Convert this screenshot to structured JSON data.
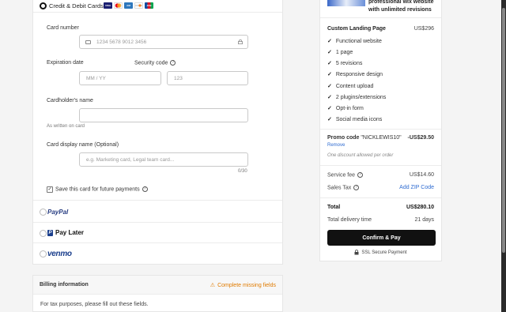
{
  "payment": {
    "credit_label": "Credit & Debit Cards",
    "card_brands": [
      "visa",
      "mastercard",
      "amex",
      "discover",
      "jcb"
    ],
    "card_number_label": "Card number",
    "card_number_placeholder": "1234 5678 9012 3456",
    "expiration_label": "Expiration date",
    "expiration_placeholder": "MM / YY",
    "security_label": "Security code",
    "security_placeholder": "123",
    "holder_label": "Cardholder's name",
    "holder_hint": "As written on card",
    "display_label": "Card display name (Optional)",
    "display_placeholder": "e.g. Marketing card, Legal team card...",
    "display_counter": "0/30",
    "save_label": "Save this card for future payments",
    "save_checked": "✓",
    "paypal_label": "PayPal",
    "paylater_label": "Pay Later",
    "paylater_icon": "P",
    "venmo_label": "venmo"
  },
  "billing": {
    "title": "Billing information",
    "warning": "Complete missing fields",
    "warning_icon": "⚠",
    "description": "For tax purposes, please fill out these fields."
  },
  "summary": {
    "gig_title": "professional wix website with unlimited revisions",
    "package_name": "Custom Landing Page",
    "package_price": "US$296",
    "check_glyph": "✓",
    "features": [
      "Functional website",
      "1 page",
      "5 revisions",
      "Responsive design",
      "Content upload",
      "2 plugins/extensions",
      "Opt-in form",
      "Social media icons"
    ],
    "promo_prefix": "Promo code",
    "promo_code": "\"NICKLEWIS10\"",
    "promo_amount": "-US$29.50",
    "remove_label": "Remove",
    "no_discount_note": "One discount allowed per order",
    "service_fee_label": "Service fee",
    "service_fee_value": "US$14.60",
    "sales_tax_label": "Sales Tax",
    "sales_tax_link": "Add ZIP Code",
    "total_label": "Total",
    "total_value": "US$280.10",
    "delivery_label": "Total delivery time",
    "delivery_value": "21 days",
    "confirm_label": "Confirm & Pay",
    "ssl_label": "SSL Secure Payment",
    "info_glyph": "?"
  },
  "colors": {
    "accent_link": "#2e6bd1",
    "warning": "#e07b00",
    "primary_button": "#111111"
  }
}
